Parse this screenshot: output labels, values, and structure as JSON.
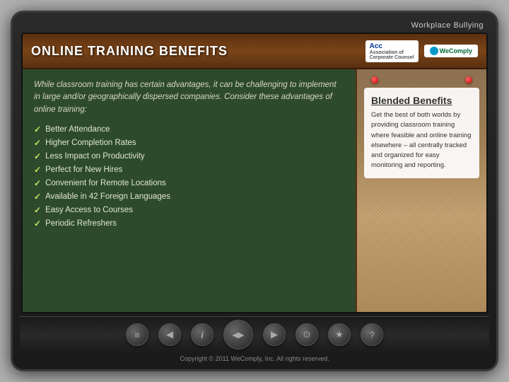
{
  "app": {
    "title": "Workplace Bullying",
    "copyright": "Copyright © 2011 WeComply, Inc. All rights reserved."
  },
  "header": {
    "title": "ONLINE TRAINING BENEFITS",
    "logo_acc": "Acc Association of Corporate Counsel",
    "logo_wecomply": "WeComply"
  },
  "left_panel": {
    "intro": "While classroom training has certain advantages, it can be challenging to implement in large and/or geographically dispersed companies. Consider these advantages of online training:",
    "benefits": [
      "Better Attendance",
      "Higher Completion Rates",
      "Less Impact on Productivity",
      "Perfect for New Hires",
      "Convenient for Remote Locations",
      "Available in 42 Foreign Languages",
      "Easy Access to Courses",
      "Periodic Refreshers"
    ]
  },
  "right_panel": {
    "blended_title": "Blended Benefits",
    "blended_text": "Get the best of both worlds by providing classroom training where feasible and online training elsewhere – all centrally tracked and organized for easy monitoring and reporting."
  },
  "nav_buttons": [
    {
      "icon": "≡",
      "label": "menu-icon"
    },
    {
      "icon": "◀",
      "label": "back-icon"
    },
    {
      "icon": "i",
      "label": "info-icon"
    },
    {
      "icon": "◀▶",
      "label": "play-icon"
    },
    {
      "icon": "▶",
      "label": "forward-icon"
    },
    {
      "icon": "⊙",
      "label": "record-icon"
    },
    {
      "icon": "★",
      "label": "star-icon"
    },
    {
      "icon": "?",
      "label": "help-icon"
    }
  ]
}
